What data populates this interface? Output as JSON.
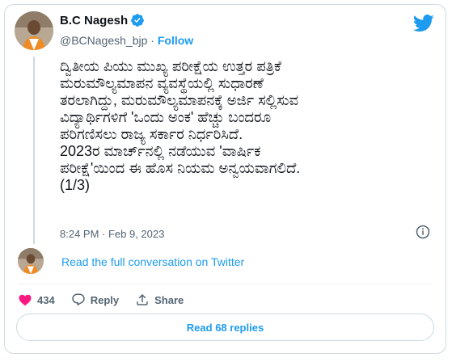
{
  "author": {
    "name": "B.C Nagesh",
    "handle": "@BCNagesh_bjp",
    "separator": "·",
    "follow_label": "Follow"
  },
  "tweet": {
    "text": "ದ್ವಿತೀಯ ಪಿಯು ಮುಖ್ಯ ಪರೀಕ್ಷೆಯ ಉತ್ತರ ಪತ್ರಿಕೆ\nಮರುಮೌಲ್ಯಮಾಪನ ವ್ಯವಸ್ಥೆಯಲ್ಲಿ ಸುಧಾರಣೆ\nತರಲಾಗಿದ್ದು, ಮರುಮೌಲ್ಯಮಾಪನಕ್ಕೆ ಅರ್ಜಿ ಸಲ್ಲಿಸುವ\nವಿದ್ಯಾರ್ಥಿಗಳಿಗೆ 'ಒಂದು ಅಂಕ' ಹೆಚ್ಚು ಬಂದರೂ\nಪರಿಗಣಿಸಲು ರಾಜ್ಯ ಸರ್ಕಾರ ನಿರ್ಧರಿಸಿದೆ.\n2023ರ ಮಾರ್ಚ್‌ನಲ್ಲಿ ನಡೆಯುವ 'ವಾರ್ಷಿಕ\nಪರೀಕ್ಷೆ'ಯಿಂದ ಈ ಹೊಸ ನಿಯಮ ಅನ್ವಯವಾಗಲಿದೆ.\n(1/3)",
    "timestamp": "8:24 PM · Feb 9, 2023"
  },
  "read_conversation_label": "Read the full conversation on Twitter",
  "actions": {
    "like_count": "434",
    "reply_label": "Reply",
    "share_label": "Share"
  },
  "read_replies_label": "Read 68 replies",
  "colors": {
    "accent": "#1d9bf0",
    "like": "#f91880",
    "secondary_text": "#536471",
    "border": "#cfd9de"
  },
  "icons": [
    "verified-badge-icon",
    "twitter-bird-icon",
    "info-icon",
    "heart-icon",
    "reply-bubble-icon",
    "share-icon"
  ]
}
